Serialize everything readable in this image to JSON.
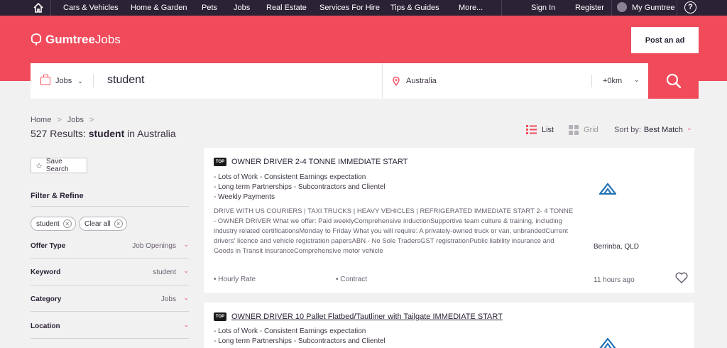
{
  "topnav": {
    "items": [
      "Cars & Vehicles",
      "Home & Garden",
      "Pets",
      "Jobs",
      "Real Estate",
      "Services For Hire",
      "Tips & Guides",
      "More..."
    ],
    "sign_in": "Sign In",
    "register": "Register",
    "my_gumtree": "My Gumtree",
    "help": "?"
  },
  "header": {
    "brand_main": "Gumtree",
    "brand_sub": "Jobs",
    "post_ad": "Post an ad"
  },
  "search": {
    "category": "Jobs",
    "keyword": "student",
    "location": "Australia",
    "radius": "+0km"
  },
  "breadcrumb": [
    "Home",
    "Jobs"
  ],
  "results": {
    "count_text": "527 Results:",
    "keyword": "student",
    "suffix": "in Australia"
  },
  "view": {
    "list_label": "List",
    "grid_label": "Grid",
    "sort_label": "Sort by:",
    "sort_value": "Best Match"
  },
  "sidebar": {
    "save_search": "Save Search",
    "filter_title": "Filter & Refine",
    "chips": [
      "student",
      "Clear all"
    ],
    "filters": [
      {
        "label": "Offer Type",
        "value": "Job Openings"
      },
      {
        "label": "Keyword",
        "value": "student"
      },
      {
        "label": "Category",
        "value": "Jobs"
      },
      {
        "label": "Location",
        "value": ""
      }
    ]
  },
  "listings": [
    {
      "badge": "TOP",
      "title": "OWNER DRIVER 2-4 TONNE IMMEDIATE START",
      "bullets": [
        "-  Lots of Work - Consistent Earnings expectation",
        "-  Long term Partnerships - Subcontractors and Clientel",
        "-  Weekly Payments"
      ],
      "description": "DRIVE WITH US COURIERS | TAXI TRUCKS | HEAVY VEHICLES | REFRIGERATED IMMEDIATE START 2- 4 TONNE - OWNER DRIVER What we offer: Paid weeklyComprehensive inductionSupportive team culture & training, including industry related certificationsMonday to Friday What you will require: A privately-owned truck or van, unbrandedCurrent drivers' licence and vehicle registration papersABN - No Sole TradersGST registrationPublic liability insurance and Goods in Transit insuranceComprehensive motor vehicle",
      "location": "Berrinba, QLD",
      "pay": "• Hourly Rate",
      "type": "• Contract",
      "posted": "11 hours ago"
    },
    {
      "badge": "TOP",
      "title": "OWNER DRIVER 10 Pallet Flatbed/Tautliner with Tailgate IMMEDIATE START",
      "bullets": [
        "-  Lots of Work - Consistent Earnings expectation",
        "-  Long term Partnerships - Subcontractors and Clientel"
      ]
    }
  ],
  "colors": {
    "brand": "#f04a5b",
    "nav": "#2b2236",
    "logo": "#1f6fb5"
  }
}
